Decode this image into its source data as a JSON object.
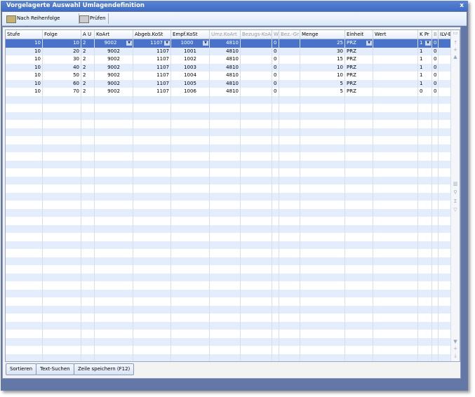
{
  "window": {
    "title": "Vorgelagerte Auswahl Umlagendefinition",
    "close": "x"
  },
  "toolbar": {
    "sort_label": "Nach Reihenfolge sortieren",
    "check_label": "Prüfen"
  },
  "columns": [
    "Stufe",
    "Folge",
    "A U",
    "KoArt",
    "Abgeb.KoSt",
    "Empf.KoSt",
    "Umz.KoArt",
    "Bezugs-KoAr",
    "W",
    "Bez.-Gr",
    "Menge",
    "Einheit",
    "Wert",
    "K Pr",
    "B",
    "ILV-B"
  ],
  "rows": [
    [
      "10",
      "10",
      "2",
      "9002",
      "1107",
      "1000",
      "4810",
      "",
      "0",
      "",
      "25",
      "PRZ",
      "",
      "1",
      "0",
      ""
    ],
    [
      "10",
      "20",
      "2",
      "9002",
      "1107",
      "1001",
      "4810",
      "",
      "0",
      "",
      "30",
      "PRZ",
      "",
      "1",
      "0",
      ""
    ],
    [
      "10",
      "30",
      "2",
      "9002",
      "1107",
      "1002",
      "4810",
      "",
      "0",
      "",
      "15",
      "PRZ",
      "",
      "1",
      "0",
      ""
    ],
    [
      "10",
      "40",
      "2",
      "9002",
      "1107",
      "1003",
      "4810",
      "",
      "0",
      "",
      "10",
      "PRZ",
      "",
      "1",
      "0",
      ""
    ],
    [
      "10",
      "50",
      "2",
      "9002",
      "1107",
      "1004",
      "4810",
      "",
      "0",
      "",
      "10",
      "PRZ",
      "",
      "1",
      "0",
      ""
    ],
    [
      "10",
      "60",
      "2",
      "9002",
      "1107",
      "1005",
      "4810",
      "",
      "0",
      "",
      "5",
      "PRZ",
      "",
      "1",
      "0",
      ""
    ],
    [
      "10",
      "70",
      "2",
      "9002",
      "1107",
      "1006",
      "4810",
      "",
      "0",
      "",
      "5",
      "PRZ",
      "",
      "0",
      "0",
      ""
    ]
  ],
  "selected_row": 0,
  "buttons": {
    "sort": "Sortieren",
    "search": "Text-Suchen",
    "save": "Zeile speichern (F12)"
  },
  "colors": {
    "title": "#3f6cc4",
    "selection": "#4a72c8",
    "alt_row": "#e3edfc",
    "frame": "#6478a8"
  }
}
